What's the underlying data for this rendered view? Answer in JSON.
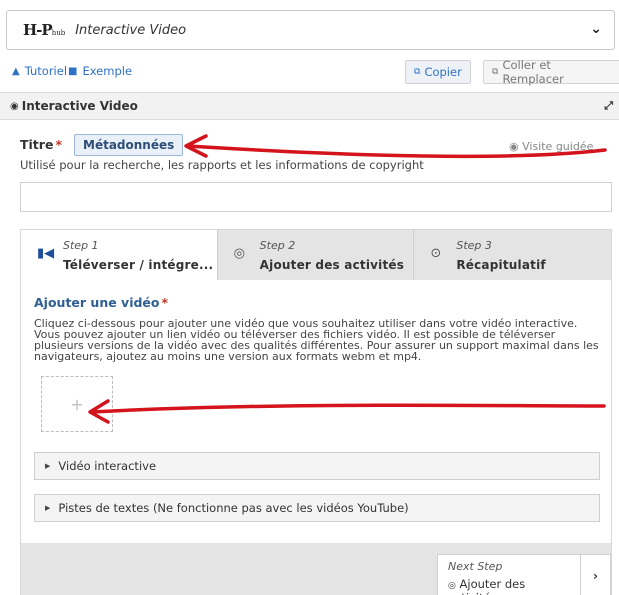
{
  "header": {
    "logo": "H-P",
    "logo_small": "hub",
    "title": "Interactive Video"
  },
  "toolbar": {
    "tutoriel": "Tutoriel",
    "exemple": "Exemple",
    "copier": "Copier",
    "coller": "Coller et Remplacer"
  },
  "section": {
    "title": "Interactive Video"
  },
  "form": {
    "titre_label": "Titre",
    "required_mark": "*",
    "metadonnees": "Métadonnées",
    "visite_guidee": "Visite guidée",
    "help_text": "Utilisé pour la recherche, les rapports et les informations de copyright",
    "title_value": ""
  },
  "steps": [
    {
      "step": "Step 1",
      "label": "Téléverser / intégre..."
    },
    {
      "step": "Step 2",
      "label": "Ajouter des activités"
    },
    {
      "step": "Step 3",
      "label": "Récapitulatif"
    }
  ],
  "video": {
    "label": "Ajouter une vidéo",
    "description": "Cliquez ci-dessous pour ajouter une vidéo que vous souhaitez utiliser dans votre vidéo interactive. Vous pouvez ajouter un lien vidéo ou téléverser des fichiers vidéo. Il est possible de téléverser plusieurs versions de la vidéo avec des qualités différentes. Pour assurer un support maximal dans les navigateurs, ajoutez au moins une version aux formats webm et mp4.",
    "add_symbol": "+",
    "collapsible_1": "Vidéo interactive",
    "collapsible_2": "Pistes de textes (Ne fonctionne pas avec les vidéos YouTube)"
  },
  "footer": {
    "next_step": "Next Step",
    "next_label": "Ajouter des activités"
  },
  "colors": {
    "accent": "#2f72c4",
    "annotation": "#d4141c"
  }
}
